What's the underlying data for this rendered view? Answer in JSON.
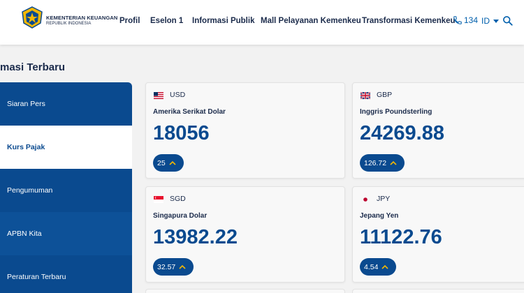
{
  "header": {
    "logo_line1": "KEMENTERIAN KEUANGAN",
    "logo_line2": "REPUBLIK INDONESIA",
    "nav": [
      "Profil",
      "Eselon 1",
      "Informasi Publik",
      "Mall Pelayanan Kemenkeu",
      "Transformasi Kemenkeu"
    ],
    "phone": "134",
    "language": "ID"
  },
  "page_title": "masi Terbaru",
  "sidebar": {
    "items": [
      "Siaran Pers",
      "Kurs Pajak",
      "Pengumuman",
      "APBN Kita",
      "Peraturan Terbaru"
    ],
    "active_index": 1
  },
  "rates": [
    {
      "code": "USD",
      "name": "Amerika Serikat Dolar",
      "value": "18056",
      "change": "25",
      "flag": "us-flag-icon"
    },
    {
      "code": "GBP",
      "name": "Inggris Poundsterling",
      "value": "24269.88",
      "change": "126.72",
      "flag": "uk-flag-icon"
    },
    {
      "code": "SGD",
      "name": "Singapura Dolar",
      "value": "13982.22",
      "change": "32.57",
      "flag": "sg-flag-icon"
    },
    {
      "code": "JPY",
      "name": "Jepang Yen",
      "value": "11122.76",
      "change": "4.54",
      "flag": "jp-flag-icon"
    }
  ],
  "colors": {
    "brand": "#0a4a8f",
    "link": "#005fac",
    "up_arrow": "#f2b705"
  }
}
